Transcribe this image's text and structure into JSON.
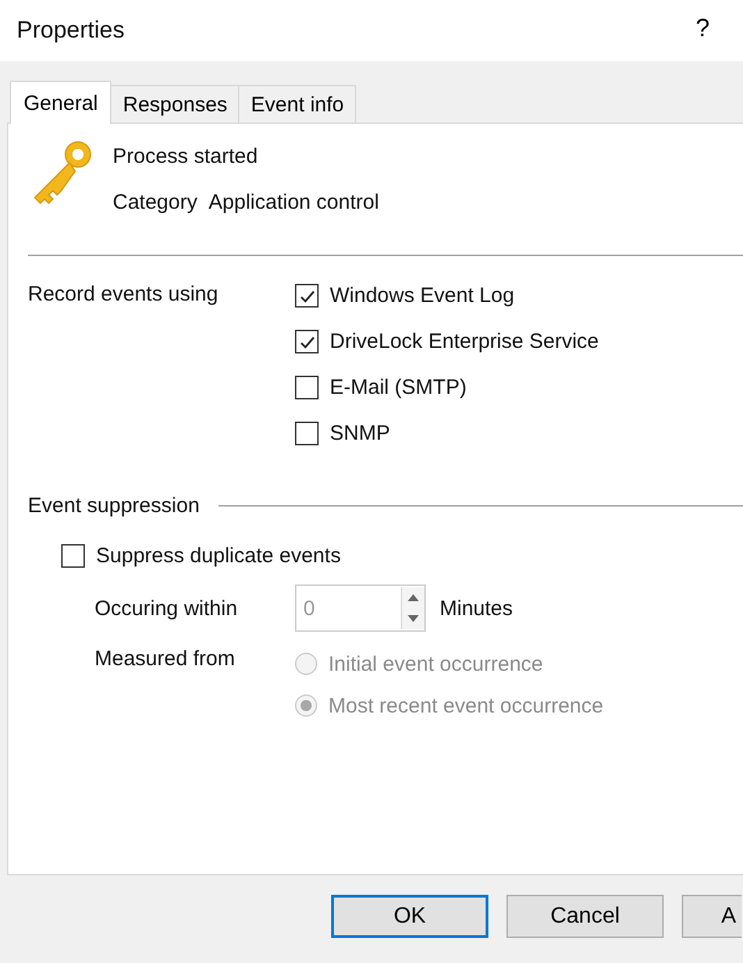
{
  "window": {
    "title": "Properties",
    "help": "?"
  },
  "tabs": [
    {
      "label": "General",
      "selected": true
    },
    {
      "label": "Responses",
      "selected": false
    },
    {
      "label": "Event info",
      "selected": false
    }
  ],
  "header": {
    "title": "Process started",
    "category_label": "Category",
    "category": "Application control"
  },
  "record": {
    "label": "Record events using",
    "options": [
      {
        "label": "Windows Event Log",
        "checked": true
      },
      {
        "label": "DriveLock Enterprise Service",
        "checked": true
      },
      {
        "label": "E-Mail (SMTP)",
        "checked": false
      },
      {
        "label": "SNMP",
        "checked": false
      }
    ]
  },
  "suppression": {
    "heading": "Event suppression",
    "suppress": {
      "label": "Suppress duplicate events",
      "checked": false
    },
    "within": {
      "label": "Occuring within",
      "value": "0",
      "unit": "Minutes",
      "disabled": true
    },
    "measured": {
      "label": "Measured from",
      "disabled": true,
      "options": [
        {
          "label": "Initial event occurrence",
          "selected": false
        },
        {
          "label": "Most recent event occurrence",
          "selected": true
        }
      ]
    }
  },
  "buttons": [
    {
      "label": "OK",
      "focused": true
    },
    {
      "label": "Cancel",
      "focused": false
    },
    {
      "label": "A",
      "focused": false
    }
  ]
}
